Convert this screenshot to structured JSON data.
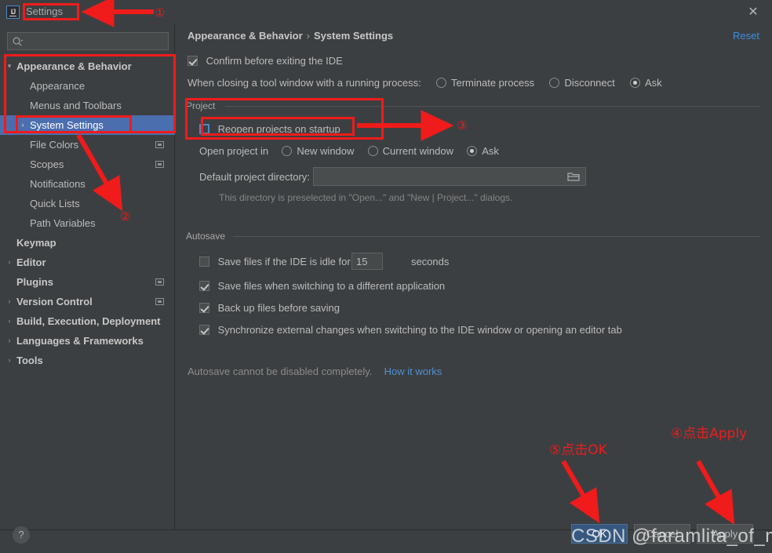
{
  "window": {
    "title": "Settings",
    "logo_text": "IJ",
    "close_icon": "✕"
  },
  "sidebar": {
    "search": {
      "placeholder": "",
      "value": "",
      "icon": "search-icon"
    },
    "items": [
      {
        "label": "Appearance & Behavior",
        "level": 0,
        "arrow": "▾",
        "bold": true,
        "selected": false,
        "scope_icon": false
      },
      {
        "label": "Appearance",
        "level": 1,
        "arrow": "",
        "bold": false,
        "selected": false,
        "scope_icon": false
      },
      {
        "label": "Menus and Toolbars",
        "level": 1,
        "arrow": "",
        "bold": false,
        "selected": false,
        "scope_icon": false
      },
      {
        "label": "System Settings",
        "level": 1,
        "arrow": "›",
        "bold": false,
        "selected": true,
        "scope_icon": false
      },
      {
        "label": "File Colors",
        "level": 1,
        "arrow": "",
        "bold": false,
        "selected": false,
        "scope_icon": true
      },
      {
        "label": "Scopes",
        "level": 1,
        "arrow": "",
        "bold": false,
        "selected": false,
        "scope_icon": true
      },
      {
        "label": "Notifications",
        "level": 1,
        "arrow": "",
        "bold": false,
        "selected": false,
        "scope_icon": false
      },
      {
        "label": "Quick Lists",
        "level": 1,
        "arrow": "",
        "bold": false,
        "selected": false,
        "scope_icon": false
      },
      {
        "label": "Path Variables",
        "level": 1,
        "arrow": "",
        "bold": false,
        "selected": false,
        "scope_icon": false
      },
      {
        "label": "Keymap",
        "level": 0,
        "arrow": "",
        "bold": true,
        "selected": false,
        "scope_icon": false
      },
      {
        "label": "Editor",
        "level": 0,
        "arrow": "›",
        "bold": true,
        "selected": false,
        "scope_icon": false
      },
      {
        "label": "Plugins",
        "level": 0,
        "arrow": "",
        "bold": true,
        "selected": false,
        "scope_icon": true
      },
      {
        "label": "Version Control",
        "level": 0,
        "arrow": "›",
        "bold": true,
        "selected": false,
        "scope_icon": true
      },
      {
        "label": "Build, Execution, Deployment",
        "level": 0,
        "arrow": "›",
        "bold": true,
        "selected": false,
        "scope_icon": false
      },
      {
        "label": "Languages & Frameworks",
        "level": 0,
        "arrow": "›",
        "bold": true,
        "selected": false,
        "scope_icon": false
      },
      {
        "label": "Tools",
        "level": 0,
        "arrow": "›",
        "bold": true,
        "selected": false,
        "scope_icon": false
      }
    ]
  },
  "main": {
    "breadcrumb": {
      "parent": "Appearance & Behavior",
      "separator": "›",
      "current": "System Settings"
    },
    "reset_label": "Reset",
    "confirm_exit": {
      "label": "Confirm before exiting the IDE",
      "checked": true
    },
    "tool_window": {
      "label": "When closing a tool window with a running process:",
      "options": [
        {
          "label": "Terminate process",
          "selected": false
        },
        {
          "label": "Disconnect",
          "selected": false
        },
        {
          "label": "Ask",
          "selected": true
        }
      ]
    },
    "project_group": {
      "title": "Project",
      "reopen": {
        "label": "Reopen projects on startup",
        "checked": false
      },
      "open_in_label": "Open project in",
      "open_in_options": [
        {
          "label": "New window",
          "selected": false
        },
        {
          "label": "Current window",
          "selected": false
        },
        {
          "label": "Ask",
          "selected": true
        }
      ],
      "dir_label": "Default project directory:",
      "dir_value": "",
      "dir_placeholder": "",
      "dir_browse_icon": "folder-icon",
      "dir_hint": "This directory is preselected in \"Open...\" and \"New | Project...\" dialogs."
    },
    "autosave_group": {
      "title": "Autosave",
      "idle": {
        "label_before": "Save files if the IDE is idle for",
        "value": "15",
        "label_after": "seconds",
        "checked": false
      },
      "items": [
        {
          "label": "Save files when switching to a different application",
          "checked": true
        },
        {
          "label": "Back up files before saving",
          "checked": true
        },
        {
          "label": "Synchronize external changes when switching to the IDE window or opening an editor tab",
          "checked": true
        }
      ],
      "footnote": "Autosave cannot be disabled completely.",
      "footnote_link": "How it works"
    }
  },
  "footer": {
    "help_icon": "?",
    "buttons": [
      {
        "label": "OK",
        "primary": true
      },
      {
        "label": "Cancel",
        "primary": false
      },
      {
        "label": "Apply",
        "primary": false
      }
    ]
  },
  "watermark": "CSDN @faramlita_of_mine",
  "annotations": {
    "accent_color": "#f01b1b",
    "markers": [
      {
        "id": "m1",
        "text": "①"
      },
      {
        "id": "m2",
        "text": "②"
      },
      {
        "id": "m3",
        "text": "③"
      }
    ],
    "notes": [
      {
        "id": "n4",
        "text": "④点击Apply"
      },
      {
        "id": "n5",
        "text": "⑤点击OK"
      }
    ]
  }
}
